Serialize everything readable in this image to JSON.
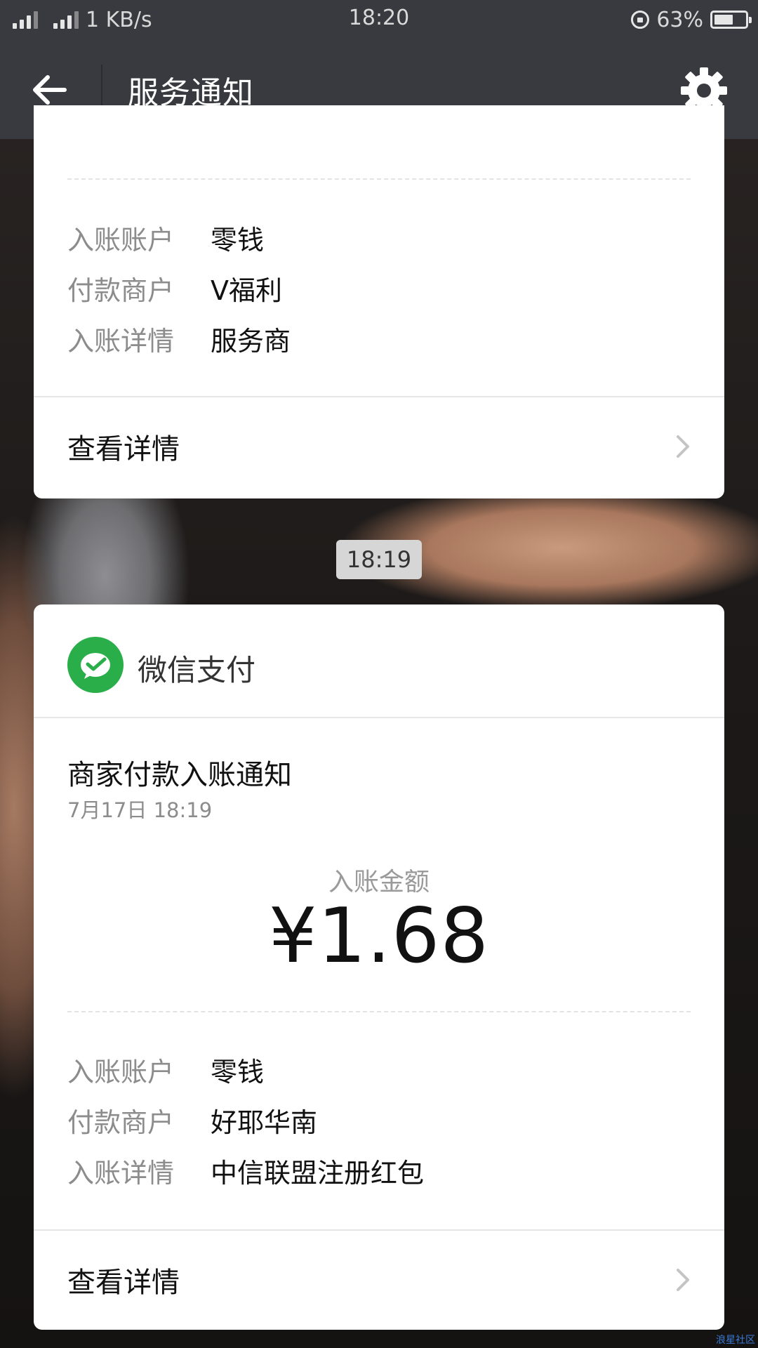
{
  "status_bar": {
    "net_speed": "1 KB/s",
    "time": "18:20",
    "battery": "63%",
    "battery_level": 0.63
  },
  "nav": {
    "title": "服务通知"
  },
  "time_divider": "18:19",
  "card_previous": {
    "fields": [
      {
        "label": "入账账户",
        "value": "零钱"
      },
      {
        "label": "付款商户",
        "value": "V福利"
      },
      {
        "label": "入账详情",
        "value": "服务商"
      }
    ],
    "detail_label": "查看详情"
  },
  "card_current": {
    "brand": "微信支付",
    "title": "商家付款入账通知",
    "date": "7月17日  18:19",
    "amount_label": "入账金额",
    "amount": "¥1.68",
    "fields": [
      {
        "label": "入账账户",
        "value": "零钱"
      },
      {
        "label": "付款商户",
        "value": "好耶华南"
      },
      {
        "label": "入账详情",
        "value": "中信联盟注册红包"
      }
    ],
    "detail_label": "查看详情"
  },
  "watermark": "浪星社区",
  "colors": {
    "nav_bg": "#393a3f",
    "wechat_pay_green": "#2aae4a",
    "card_bg": "#ffffff"
  },
  "icons": {
    "back": "arrow-left-icon",
    "settings": "gear-icon",
    "detail": "chevron-right-icon",
    "brand": "wechat-pay-icon"
  }
}
